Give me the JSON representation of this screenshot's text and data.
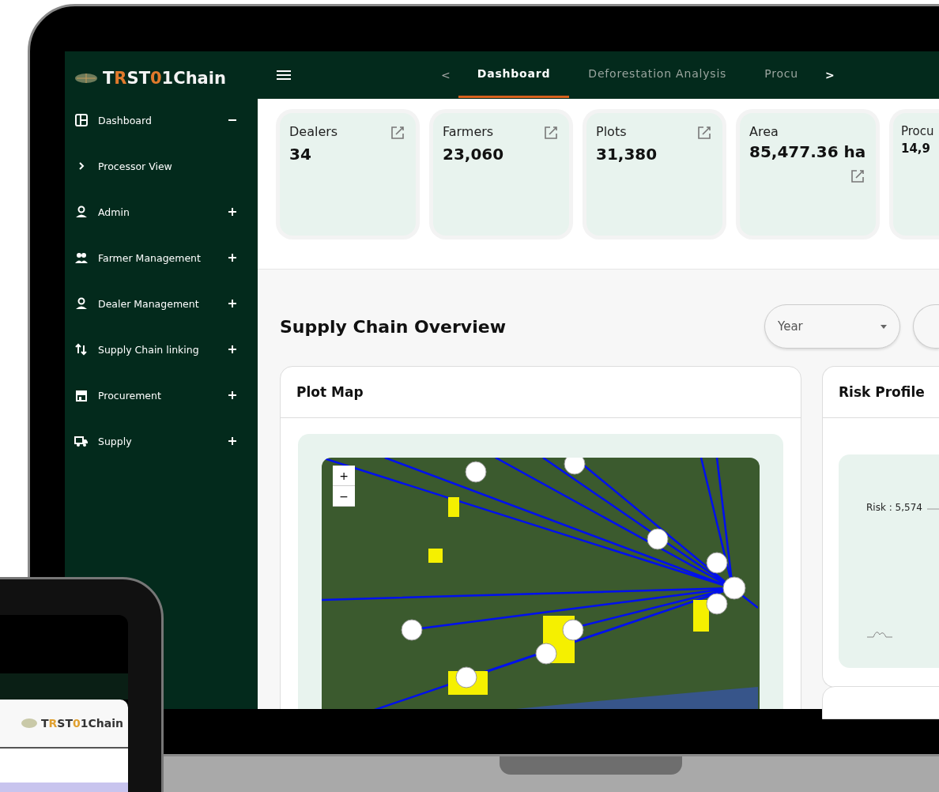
{
  "sidebar": {
    "logo": "TRST01Chain",
    "items": [
      {
        "label": "Dashboard",
        "kind": "dashboard",
        "expanded": true,
        "children": [
          {
            "label": "Processor View"
          }
        ]
      },
      {
        "label": "Admin",
        "kind": "person",
        "expanded": false
      },
      {
        "label": "Farmer Management",
        "kind": "people",
        "expanded": false
      },
      {
        "label": "Dealer Management",
        "kind": "person",
        "expanded": false
      },
      {
        "label": "Supply Chain linking",
        "kind": "arrows",
        "expanded": false
      },
      {
        "label": "Procurement",
        "kind": "store",
        "expanded": false
      },
      {
        "label": "Supply",
        "kind": "truck",
        "expanded": false
      }
    ]
  },
  "topbar": {
    "prev": "<",
    "next": ">",
    "tabs": [
      {
        "label": "Dashboard",
        "selected": true
      },
      {
        "label": "Deforestation Analysis",
        "selected": false
      },
      {
        "label": "Procu",
        "selected": false
      }
    ]
  },
  "stats": [
    {
      "label": "Dealers",
      "value": "34",
      "kind": "edit_top"
    },
    {
      "label": "Farmers",
      "value": "23,060",
      "kind": "edit_top"
    },
    {
      "label": "Plots",
      "value": "31,380",
      "kind": "edit_top"
    },
    {
      "label": "Area",
      "value": "85,477.36 ha",
      "kind": "edit_below"
    },
    {
      "label": "Procu",
      "value": "14,9",
      "kind": "cut"
    }
  ],
  "overview": {
    "title": "Supply Chain Overview",
    "filter": {
      "placeholder": "Year"
    }
  },
  "plot_map": {
    "title": "Plot Map",
    "zoom_in": "+",
    "zoom_out": "−"
  },
  "risk_profile": {
    "title": "Risk Profile",
    "label": "Risk : 5,574"
  },
  "phone": {
    "logo": "TRST01Chain"
  }
}
